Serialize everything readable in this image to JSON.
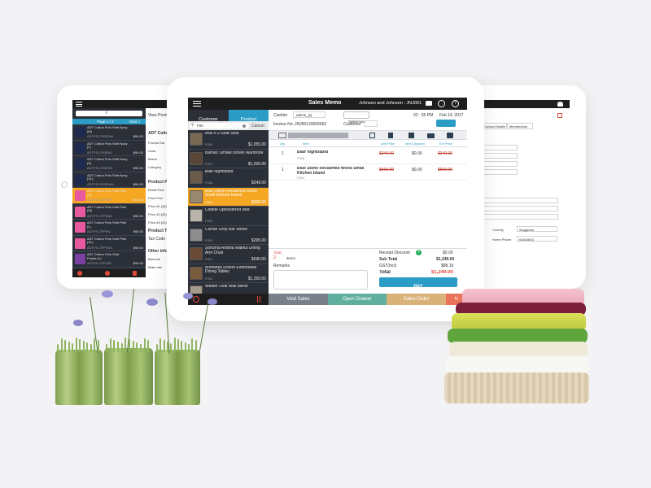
{
  "left_tablet": {
    "search_placeholder": "",
    "page_label": "Page 1 / 2",
    "next_label": "Next >",
    "items": [
      {
        "name": "ADT Cotton Polo Shirt Navy (M)",
        "sku": "ADTPS-CPBRNM",
        "price": "$90.00",
        "color": "#1e2a4e"
      },
      {
        "name": "ADT Cotton Polo Shirt Navy (L)",
        "sku": "ADTPS-CPBRNL",
        "price": "$90.00",
        "color": "#1e2a4e"
      },
      {
        "name": "ADT Cotton Polo Shirt Navy (S)",
        "sku": "ADTPS-CPBRNS",
        "price": "$90.00",
        "color": "#1e2a4e"
      },
      {
        "name": "ADT Cotton Polo Shirt Navy (XL)",
        "sku": "ADTPS-CPBRNXL",
        "price": "$90.00",
        "color": "#1e2a4e"
      },
      {
        "name": "ADT Cotton Polo Shirt Pink (S)",
        "sku": "ADTPS-CPPINS",
        "price": "$90.00",
        "color": "#e75aa0"
      },
      {
        "name": "ADT Cotton Polo Shirt Pink (M)",
        "sku": "ADTPS-CPPINM",
        "price": "$90.00",
        "color": "#e75aa0"
      },
      {
        "name": "ADT Cotton Polo Shirt Pink (L)",
        "sku": "ADTPS-CPPINL",
        "price": "$90.00",
        "color": "#e75aa0"
      },
      {
        "name": "ADT Cotton Polo Shirt Pink (XL)",
        "sku": "ADTPS-CPPINXL",
        "price": "$90.00",
        "color": "#e75aa0"
      },
      {
        "name": "ADT Cotton Polo Shirt Purple (L)",
        "sku": "ADTPS-CPPURL",
        "price": "$90.00",
        "color": "#7a3fa0"
      }
    ],
    "view_product_label": "View Prod",
    "detail_title": "ADT Cotto",
    "detail_fields": [
      "Product Na",
      "Code",
      "Brand",
      "Category"
    ],
    "pricing_title": "Product P",
    "pricing_fields": [
      "Retail Price",
      "Price Free",
      "Price #1 (Qt)",
      "Price #2 (Qt)",
      "Price #3 (Qt)"
    ],
    "tax_title": "Product Ta",
    "tax_field": "Tax Code",
    "other_title": "Other info",
    "other_fields": [
      "Barcode",
      "Make info"
    ]
  },
  "right_tablet": {
    "tabs": [
      "Contact Details",
      "Membership"
    ],
    "country_label": "Country",
    "country_value": "Singapore",
    "home_phone_label": "Home Phone",
    "home_phone_value": "63404803"
  },
  "main": {
    "title": "Sales Memo",
    "customer_name": "Johnson and Johnson : JNJ001",
    "tab_customer": "Customer",
    "tab_product": "Product",
    "search_value": "F00",
    "cancel_label": "Cancel",
    "products": [
      {
        "name": "Axis II 2-Seat Sofa",
        "sku": "F009",
        "price": "$1,055.00",
        "color": "#7a6a55"
      },
      {
        "name": "Barnes Smoke Brown Wardrobe",
        "sku": "F007",
        "price": "$1,030.00",
        "color": "#5a4636"
      },
      {
        "name": "Blair nightstand",
        "sku": "F008",
        "price": "$349.00",
        "color": "#6a5a48"
      },
      {
        "name": "Blue Stone Reclaimed Wood Small Kitchen Island",
        "sku": "F004",
        "price": "$569.00",
        "color": "#9a8a70"
      },
      {
        "name": "Colette Upholstered Bed",
        "sku": "F006",
        "price": "",
        "color": "#b9b3aa"
      },
      {
        "name": "Curran Grey Bar Stools",
        "sku": "F003",
        "price": "$295.00",
        "color": "#8e8e8e"
      },
      {
        "name": "Sonoma Arotina Walnut Dining Arm Chair",
        "sku": "F001",
        "price": "$540.00",
        "color": "#6b4a35"
      },
      {
        "name": "Winnetka Round Extendable Dining Tables",
        "sku": "F002",
        "price": "$1,250.00",
        "color": "#7a5a3c"
      },
      {
        "name": "Welder Oval Wall Mirror",
        "sku": "",
        "price": "",
        "color": "#a59a8c"
      }
    ],
    "selected_index": 3,
    "cashier_label": "Cashier",
    "cashier_value": "admin_jnj",
    "salesman_label": "Salesman",
    "time_value": "02 : 55 PM",
    "date_value": "Feb 14, 2017",
    "invoice_label": "Invoice No.",
    "invoice_value": "JNJ00133006662",
    "customer_label": "Customer",
    "sort_label": "Sort",
    "columns": [
      "Qty",
      "Item",
      "Unit Price",
      "Item Discount",
      "Ext Price"
    ],
    "lines": [
      {
        "qty": "1",
        "item": "Blair nightstand",
        "sku": "F008",
        "unit": "$349.00",
        "disc": "$0.00",
        "ext": "$349.00"
      },
      {
        "qty": "1",
        "item": "Blue Stone Reclaimed Wood Small Kitchen Island",
        "sku": "F004",
        "unit": "$569.00",
        "disc": "$0.00",
        "ext": "$569.00"
      }
    ],
    "total_qty_label": "Total",
    "total_qty_value": "2",
    "items_label": "items",
    "remarks_label": "Remarks",
    "receipt_discount_label": "Receipt Discount",
    "receipt_discount_value": "$0.00",
    "subtotal_label": "Sub Total",
    "subtotal_value": "$1,249.00",
    "gst_label": "GST(Incl)",
    "gst_value": "$88.19",
    "total_label": "Total",
    "total_value": "$1,249.00",
    "pay_label": "PAY",
    "void_label": "Void Sales",
    "drawer_label": "Open Drawer",
    "order_label": "Sales Order",
    "accent": "#2b9cc5",
    "highlight": "#f5a623"
  }
}
